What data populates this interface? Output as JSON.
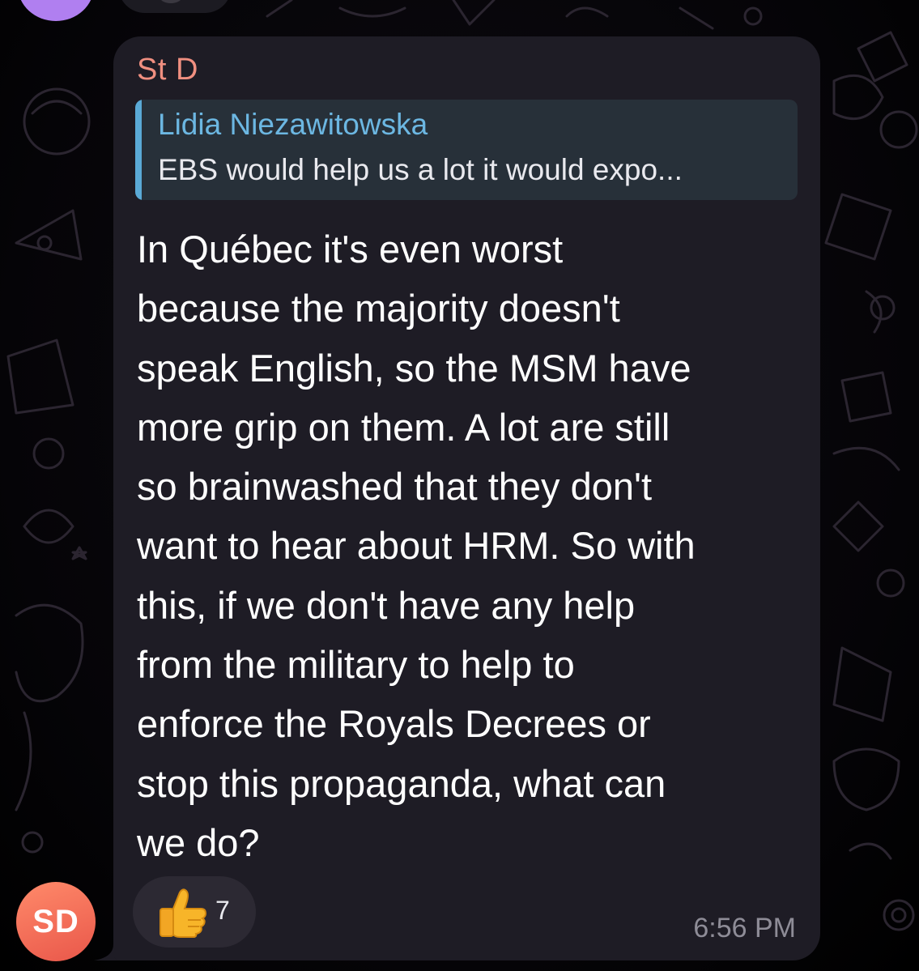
{
  "message": {
    "sender_name": "St D",
    "sender_color": "#f08f80",
    "reply": {
      "author": "Lidia Niezawitowska",
      "preview": "EBS would help us a lot it would expo..."
    },
    "text": "In Québec it's even worst\nbecause the majority doesn't\nspeak English, so the MSM have\nmore grip on them. A lot are still\nso brainwashed that they don't\nwant to hear about HRM. So with\nthis, if we don't have any help\nfrom the military to help to\nenforce the Royals Decrees or\nstop this propaganda, what can\nwe do?",
    "reaction": {
      "emoji": "thumbs-up-icon",
      "count": "7"
    },
    "timestamp": "6:56 PM"
  },
  "avatar": {
    "initials": "SD",
    "color": "#e9574a"
  },
  "top_avatar_color": "#b07ff0"
}
